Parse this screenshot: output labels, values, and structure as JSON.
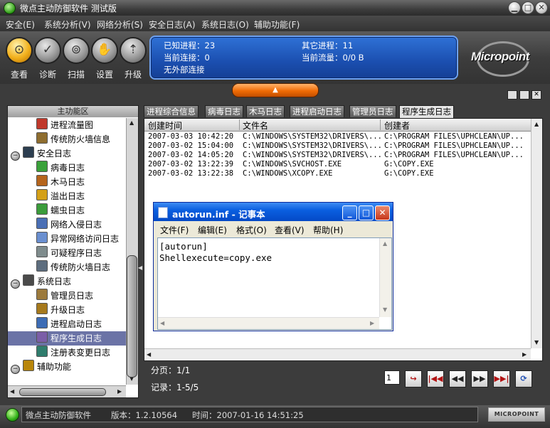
{
  "window": {
    "title": "微点主动防御软件  测试版"
  },
  "menu": [
    {
      "label": "安全(E)"
    },
    {
      "label": "系统分析(V)"
    },
    {
      "label": "网络分析(S)"
    },
    {
      "label": "安全日志(A)"
    },
    {
      "label": "系统日志(O)"
    },
    {
      "label": "辅助功能(F)"
    }
  ],
  "toolbar": [
    {
      "label": "查看",
      "icon": "magnifier-icon"
    },
    {
      "label": "诊断",
      "icon": "diagnose-icon"
    },
    {
      "label": "扫描",
      "icon": "scan-icon"
    },
    {
      "label": "设置",
      "icon": "settings-icon"
    },
    {
      "label": "升级",
      "icon": "upgrade-icon"
    }
  ],
  "status": {
    "known_processes": "已知进程：23",
    "other_processes": "其它进程：11",
    "current_connections": "当前连接：0",
    "current_traffic": "当前流量：0/0 B",
    "external_connections": "无外部连接"
  },
  "logo": {
    "text": "Micropoint"
  },
  "left_panel": {
    "header": "主功能区",
    "items": [
      {
        "label": "进程流量图",
        "level": 2,
        "icon": "chart-icon"
      },
      {
        "label": "传统防火墙信息",
        "level": 2,
        "icon": "firewall-icon"
      },
      {
        "label": "安全日志",
        "level": 1,
        "icon": "log-icon"
      },
      {
        "label": "病毒日志",
        "level": 2,
        "icon": "virus-icon"
      },
      {
        "label": "木马日志",
        "level": 2,
        "icon": "trojan-icon"
      },
      {
        "label": "溢出日志",
        "level": 2,
        "icon": "overflow-icon"
      },
      {
        "label": "蠕虫日志",
        "level": 2,
        "icon": "worm-icon"
      },
      {
        "label": "网络入侵日志",
        "level": 2,
        "icon": "intrusion-icon"
      },
      {
        "label": "异常网络访问日志",
        "level": 2,
        "icon": "network-icon"
      },
      {
        "label": "可疑程序日志",
        "level": 2,
        "icon": "suspicious-icon"
      },
      {
        "label": "传统防火墙日志",
        "level": 2,
        "icon": "firewall-log-icon"
      },
      {
        "label": "系统日志",
        "level": 1,
        "icon": "system-icon"
      },
      {
        "label": "管理员日志",
        "level": 2,
        "icon": "admin-icon"
      },
      {
        "label": "升级日志",
        "level": 2,
        "icon": "upgrade-log-icon"
      },
      {
        "label": "进程启动日志",
        "level": 2,
        "icon": "process-icon"
      },
      {
        "label": "程序生成日志",
        "level": 2,
        "icon": "program-icon",
        "selected": true
      },
      {
        "label": "注册表变更日志",
        "level": 2,
        "icon": "registry-icon"
      },
      {
        "label": "辅助功能",
        "level": 1,
        "icon": "tools-icon"
      }
    ]
  },
  "tabs": [
    {
      "label": "进程综合信息"
    },
    {
      "label": "病毒日志"
    },
    {
      "label": "木马日志"
    },
    {
      "label": "进程启动日志"
    },
    {
      "label": "管理员日志"
    },
    {
      "label": "程序生成日志",
      "active": true
    }
  ],
  "table": {
    "columns": [
      "创建时间",
      "文件名",
      "创建者"
    ],
    "rows": [
      [
        "2007-03-03 10:42:20",
        "C:\\WINDOWS\\SYSTEM32\\DRIVERS\\...",
        "C:\\PROGRAM FILES\\UPHCLEAN\\UP..."
      ],
      [
        "2007-03-02 15:04:00",
        "C:\\WINDOWS\\SYSTEM32\\DRIVERS\\...",
        "C:\\PROGRAM FILES\\UPHCLEAN\\UP..."
      ],
      [
        "2007-03-02 14:05:20",
        "C:\\WINDOWS\\SYSTEM32\\DRIVERS\\...",
        "C:\\PROGRAM FILES\\UPHCLEAN\\UP..."
      ],
      [
        "2007-03-02 13:22:39",
        "C:\\WINDOWS\\SVCHOST.EXE",
        "G:\\COPY.EXE"
      ],
      [
        "2007-03-02 13:22:38",
        "C:\\WINDOWS\\XCOPY.EXE",
        "G:\\COPY.EXE"
      ]
    ]
  },
  "notepad": {
    "title": "autorun.inf - 记事本",
    "menu": [
      "文件(F)",
      "编辑(E)",
      "格式(O)",
      "查看(V)",
      "帮助(H)"
    ],
    "lines": [
      "[autorun]",
      "Shellexecute=copy.exe"
    ]
  },
  "pager": {
    "page": "分页：1/1",
    "records": "记录：1-5/5",
    "page_input": "1"
  },
  "statusbar": {
    "app": "微点主动防御软件",
    "version": "版本：1.2.10564",
    "time": "时间：2007-01-16 14:51:25",
    "logo": "MICROPOINT"
  },
  "colors": {
    "accent": "#2f71d6",
    "selected": "#6b73a6",
    "handle": "#f06b05"
  }
}
